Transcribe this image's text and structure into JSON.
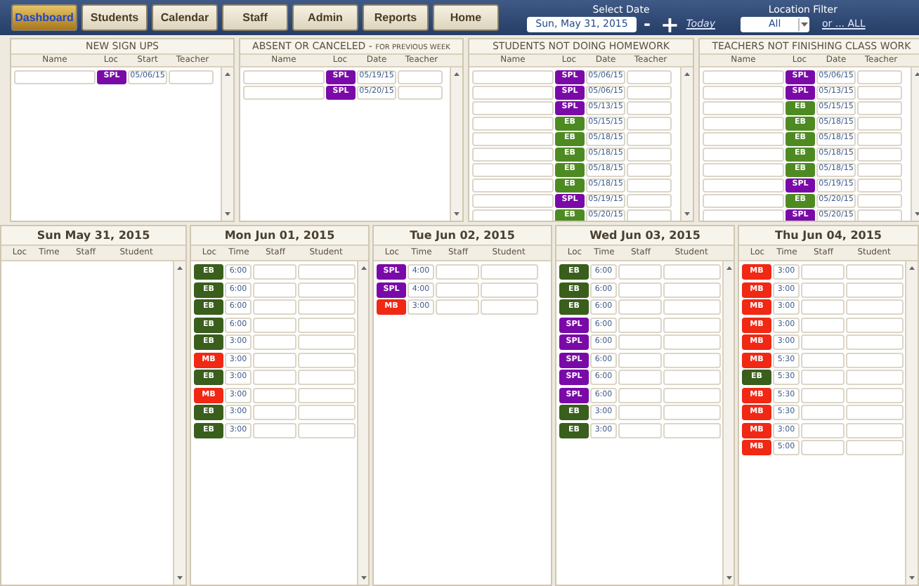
{
  "nav": [
    {
      "label": "Dashboard",
      "selected": true
    },
    {
      "label": "Students",
      "selected": false
    },
    {
      "label": "Calendar",
      "selected": false
    },
    {
      "label": "Staff",
      "selected": false
    },
    {
      "label": "Admin",
      "selected": false
    },
    {
      "label": "Reports",
      "selected": false
    },
    {
      "label": "Home",
      "selected": false
    }
  ],
  "date_picker": {
    "label": "Select Date",
    "value": "Sun, May 31, 2015",
    "minus": "-",
    "plus": "+",
    "today": "Today"
  },
  "location_filter": {
    "label": "Location Filter",
    "value": "All",
    "all_link": "or ... ALL"
  },
  "panels": [
    {
      "title": "NEW SIGN UPS",
      "columns": [
        "Name",
        "Loc",
        "Start",
        "Teacher"
      ],
      "rows": [
        {
          "loc": "SPL",
          "color": "#7a0aa8",
          "date": "05/06/15"
        }
      ]
    },
    {
      "title": "ABSENT OR CANCELED - ",
      "subtitle": "FOR PREVIOUS WEEK",
      "columns": [
        "Name",
        "Loc",
        "Date",
        "Teacher"
      ],
      "rows": [
        {
          "loc": "SPL",
          "color": "#7a0aa8",
          "date": "05/19/15"
        },
        {
          "loc": "SPL",
          "color": "#7a0aa8",
          "date": "05/20/15"
        }
      ]
    },
    {
      "title": "STUDENTS NOT DOING HOMEWORK",
      "columns": [
        "Name",
        "Loc",
        "Date",
        "Teacher"
      ],
      "rows": [
        {
          "loc": "SPL",
          "color": "#7a0aa8",
          "date": "05/06/15"
        },
        {
          "loc": "SPL",
          "color": "#7a0aa8",
          "date": "05/06/15"
        },
        {
          "loc": "SPL",
          "color": "#7a0aa8",
          "date": "05/13/15"
        },
        {
          "loc": "EB",
          "color": "#4e8a22",
          "date": "05/15/15"
        },
        {
          "loc": "EB",
          "color": "#4e8a22",
          "date": "05/18/15"
        },
        {
          "loc": "EB",
          "color": "#4e8a22",
          "date": "05/18/15"
        },
        {
          "loc": "EB",
          "color": "#4e8a22",
          "date": "05/18/15"
        },
        {
          "loc": "EB",
          "color": "#4e8a22",
          "date": "05/18/15"
        },
        {
          "loc": "SPL",
          "color": "#7a0aa8",
          "date": "05/19/15"
        },
        {
          "loc": "EB",
          "color": "#4e8a22",
          "date": "05/20/15"
        }
      ]
    },
    {
      "title": "TEACHERS NOT FINISHING CLASS WORK",
      "columns": [
        "Name",
        "Loc",
        "Date",
        "Teacher"
      ],
      "rows": [
        {
          "loc": "SPL",
          "color": "#7a0aa8",
          "date": "05/06/15"
        },
        {
          "loc": "SPL",
          "color": "#7a0aa8",
          "date": "05/13/15"
        },
        {
          "loc": "EB",
          "color": "#4e8a22",
          "date": "05/15/15"
        },
        {
          "loc": "EB",
          "color": "#4e8a22",
          "date": "05/18/15"
        },
        {
          "loc": "EB",
          "color": "#4e8a22",
          "date": "05/18/15"
        },
        {
          "loc": "EB",
          "color": "#4e8a22",
          "date": "05/18/15"
        },
        {
          "loc": "EB",
          "color": "#4e8a22",
          "date": "05/18/15"
        },
        {
          "loc": "SPL",
          "color": "#7a0aa8",
          "date": "05/19/15"
        },
        {
          "loc": "EB",
          "color": "#4e8a22",
          "date": "05/20/15"
        },
        {
          "loc": "SPL",
          "color": "#7a0aa8",
          "date": "05/20/15"
        }
      ]
    }
  ],
  "days": [
    {
      "title": "Sun  May 31, 2015",
      "columns": [
        "Loc",
        "Time",
        "Staff",
        "Student"
      ],
      "scrollbar": true
    },
    {
      "title": "Mon  Jun 01, 2015",
      "columns": [
        "Loc",
        "Time",
        "Staff",
        "Student"
      ],
      "scrollbar": true,
      "rows": [
        {
          "loc": "EB",
          "color": "#3a5e1c",
          "time": "6:00"
        },
        {
          "loc": "EB",
          "color": "#3a5e1c",
          "time": "6:00"
        },
        {
          "loc": "EB",
          "color": "#3a5e1c",
          "time": "6:00"
        },
        {
          "loc": "EB",
          "color": "#3a5e1c",
          "time": "6:00"
        },
        {
          "loc": "EB",
          "color": "#3a5e1c",
          "time": "3:00"
        },
        {
          "loc": "MB",
          "color": "#f02814",
          "time": "3:00"
        },
        {
          "loc": "EB",
          "color": "#3a5e1c",
          "time": "3:00"
        },
        {
          "loc": "MB",
          "color": "#f02814",
          "time": "3:00"
        },
        {
          "loc": "EB",
          "color": "#3a5e1c",
          "time": "3:00"
        },
        {
          "loc": "EB",
          "color": "#3a5e1c",
          "time": "3:00"
        }
      ]
    },
    {
      "title": "Tue  Jun 02, 2015",
      "columns": [
        "Loc",
        "Time",
        "Staff",
        "Student"
      ],
      "scrollbar": false,
      "rows": [
        {
          "loc": "SPL",
          "color": "#7a0aa8",
          "time": "4:00"
        },
        {
          "loc": "SPL",
          "color": "#7a0aa8",
          "time": "4:00"
        },
        {
          "loc": "MB",
          "color": "#f02814",
          "time": "3:00"
        }
      ]
    },
    {
      "title": "Wed  Jun 03, 2015",
      "columns": [
        "Loc",
        "Time",
        "Staff",
        "Student"
      ],
      "scrollbar": true,
      "rows": [
        {
          "loc": "EB",
          "color": "#3a5e1c",
          "time": "6:00"
        },
        {
          "loc": "EB",
          "color": "#3a5e1c",
          "time": "6:00"
        },
        {
          "loc": "EB",
          "color": "#3a5e1c",
          "time": "6:00"
        },
        {
          "loc": "SPL",
          "color": "#7a0aa8",
          "time": "6:00"
        },
        {
          "loc": "SPL",
          "color": "#7a0aa8",
          "time": "6:00"
        },
        {
          "loc": "SPL",
          "color": "#7a0aa8",
          "time": "6:00"
        },
        {
          "loc": "SPL",
          "color": "#7a0aa8",
          "time": "6:00"
        },
        {
          "loc": "SPL",
          "color": "#7a0aa8",
          "time": "6:00"
        },
        {
          "loc": "EB",
          "color": "#3a5e1c",
          "time": "3:00"
        },
        {
          "loc": "EB",
          "color": "#3a5e1c",
          "time": "3:00"
        }
      ]
    },
    {
      "title": "Thu  Jun 04, 2015",
      "columns": [
        "Loc",
        "Time",
        "Staff",
        "Student"
      ],
      "scrollbar": true,
      "rows": [
        {
          "loc": "MB",
          "color": "#f02814",
          "time": "3:00"
        },
        {
          "loc": "MB",
          "color": "#f02814",
          "time": "3:00"
        },
        {
          "loc": "MB",
          "color": "#f02814",
          "time": "3:00"
        },
        {
          "loc": "MB",
          "color": "#f02814",
          "time": "3:00"
        },
        {
          "loc": "MB",
          "color": "#f02814",
          "time": "3:00"
        },
        {
          "loc": "MB",
          "color": "#f02814",
          "time": "5:30"
        },
        {
          "loc": "EB",
          "color": "#3a5e1c",
          "time": "5:30"
        },
        {
          "loc": "MB",
          "color": "#f02814",
          "time": "5:30"
        },
        {
          "loc": "MB",
          "color": "#f02814",
          "time": "5:30"
        },
        {
          "loc": "MB",
          "color": "#f02814",
          "time": "3:00"
        },
        {
          "loc": "MB",
          "color": "#f02814",
          "time": "5:00"
        }
      ]
    }
  ]
}
